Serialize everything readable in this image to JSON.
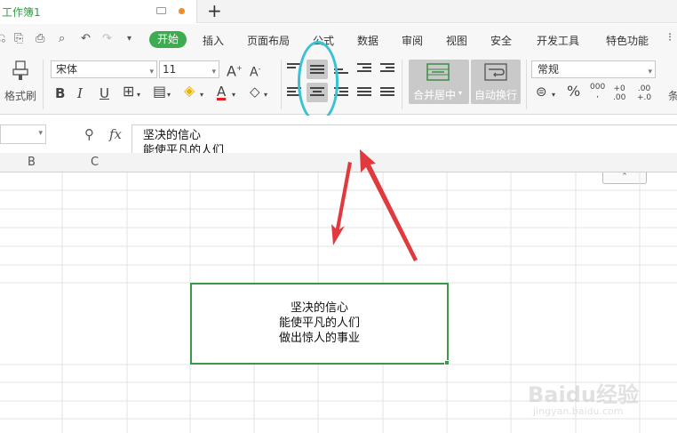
{
  "titlebar": {
    "doc_name": "工作簿1",
    "new_tab": "+"
  },
  "menu": {
    "items": [
      "开始",
      "插入",
      "页面布局",
      "公式",
      "数据",
      "审阅",
      "视图",
      "安全",
      "开发工具",
      "特色功能"
    ]
  },
  "toolbar": {
    "format_painter": "格式刷",
    "font_name": "宋体",
    "font_size": "11",
    "merge_center": "合并居中",
    "wrap_text": "自动换行",
    "number_format": "常规",
    "percent": "%",
    "thousands": "000",
    "inc_decimal_top": "+0",
    "inc_decimal_bottom": ".00",
    "dec_decimal_top": ".00",
    "dec_decimal_bottom": "+.0",
    "cond_format_partial": "条"
  },
  "formula_bar": {
    "fx": "fx",
    "content": "坚决的信心\n能使平凡的人们\n做出惊人的事业"
  },
  "columns": [
    "B",
    "C"
  ],
  "cell": {
    "content": "坚决的信心\n能使平凡的人们\n做出惊人的事业"
  },
  "watermark": {
    "main": "Baidu经验",
    "sub": "jingyan.baidu.com"
  },
  "colors": {
    "accent_green": "#3dab4f",
    "annotation_circle": "#38c2d4",
    "annotation_arrow": "#e0393e"
  }
}
